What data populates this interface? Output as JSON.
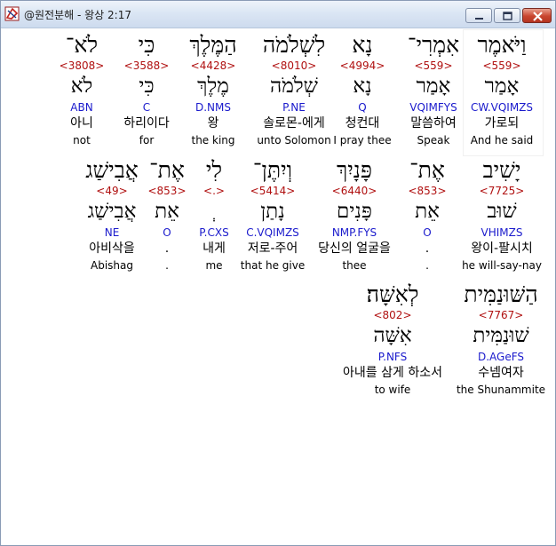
{
  "window": {
    "title": "@원전분해 - 왕상 2:17"
  },
  "rows": [
    {
      "words": [
        {
          "hebrew": "וַיֹּאמֶר",
          "strong": "<559>",
          "lemma": "אָמַר",
          "morph": "CW.VQIMZS",
          "korean": "가로되",
          "english": "And he said",
          "selected": true
        },
        {
          "hebrew": "אִמְרִי־",
          "strong": "<559>",
          "lemma": "אָמַר",
          "morph": "VQIMFYS",
          "korean": "말씀하여",
          "english": "Speak"
        },
        {
          "hebrew": "נָא",
          "strong": "<4994>",
          "lemma": "נָא",
          "morph": "Q",
          "korean": "청컨대",
          "english": "I pray thee"
        },
        {
          "hebrew": "לִשְׁלֹמֹה",
          "strong": "<8010>",
          "lemma": "שְׁלֹמֹה",
          "morph": "P.NE",
          "korean": "솔로몬-에게",
          "english": "unto Solomon"
        },
        {
          "hebrew": "הַמֶּלֶךְ",
          "strong": "<4428>",
          "lemma": "מֶלֶךְ",
          "morph": "D.NMS",
          "korean": "왕",
          "english": "the king"
        },
        {
          "hebrew": "כִּי",
          "strong": "<3588>",
          "lemma": "כִּי",
          "morph": "C",
          "korean": "하리이다",
          "english": "for"
        },
        {
          "hebrew": "לֹא־",
          "strong": "<3808>",
          "lemma": "לֹא",
          "morph": "ABN",
          "korean": "아니",
          "english": "not"
        }
      ]
    },
    {
      "words": [
        {
          "hebrew": "יָשִׁיב",
          "strong": "<7725>",
          "lemma": "שׁוּב",
          "morph": "VHIMZS",
          "korean": "왕이-팔시치",
          "english": "he will-say-nay"
        },
        {
          "hebrew": "אֶת־",
          "strong": "<853>",
          "lemma": "אֵת",
          "morph": "O",
          "korean": ".",
          "english": "."
        },
        {
          "hebrew": "פָּנָיִךְ",
          "strong": "<6440>",
          "lemma": "פָּנִים",
          "morph": "NMP.FYS",
          "korean": "당신의 얼굴을",
          "english": "thee"
        },
        {
          "hebrew": "וְיִתֶּן־",
          "strong": "<5414>",
          "lemma": "נָתַן",
          "morph": "C.VQIMZS",
          "korean": "저로-주어",
          "english": "that he give"
        },
        {
          "hebrew": "לִי",
          "strong": "<.>",
          "lemma": "ְ",
          "morph": "P.CXS",
          "korean": "내게",
          "english": "me"
        },
        {
          "hebrew": "אֶת־",
          "strong": "<853>",
          "lemma": "אֵת",
          "morph": "O",
          "korean": ".",
          "english": "."
        },
        {
          "hebrew": "אֲבִישַׁג",
          "strong": "<49>",
          "lemma": "אֲבִישַׁג",
          "morph": "NE",
          "korean": "아비삭을",
          "english": "Abishag"
        }
      ]
    },
    {
      "words": [
        {
          "hebrew": "הַשּׁוּנַמִּית",
          "strong": "<7767>",
          "lemma": "שׁוּנַמִּית",
          "morph": "D.AGeFS",
          "korean": "수넴여자",
          "english": "the Shunammite"
        },
        {
          "hebrew": "לְאִשָּׁה׃",
          "strong": "<802>",
          "lemma": "אִשָּׁה",
          "morph": "P.NFS",
          "korean": "아내를 삼게 하소서",
          "english": "to wife"
        }
      ]
    }
  ]
}
